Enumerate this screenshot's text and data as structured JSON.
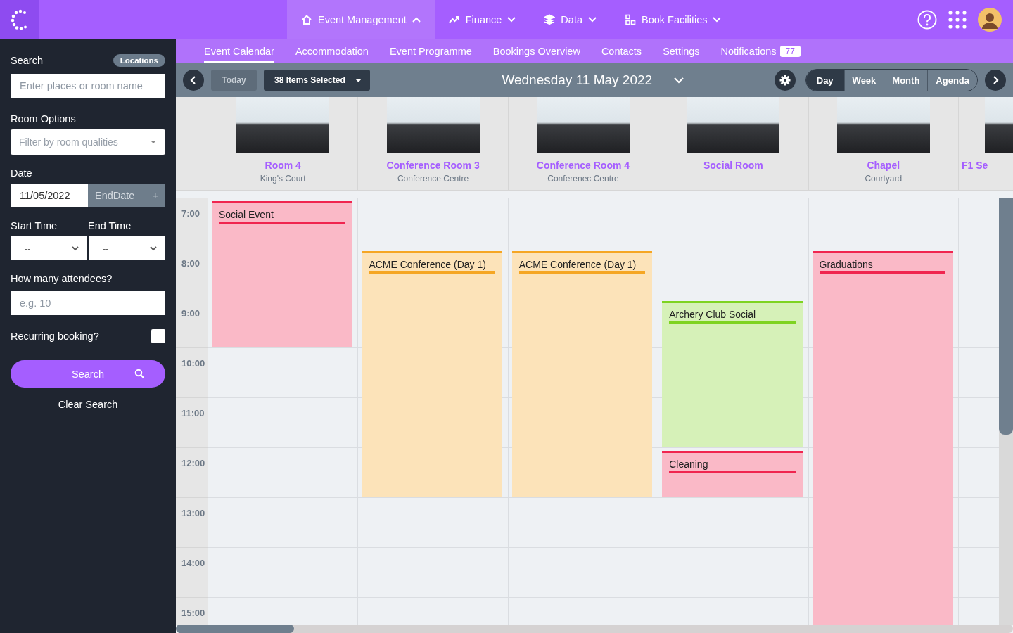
{
  "top_nav": [
    {
      "label": "Event Management",
      "expanded": true
    },
    {
      "label": "Finance",
      "expanded": false
    },
    {
      "label": "Data",
      "expanded": false
    },
    {
      "label": "Book Facilities",
      "expanded": false
    }
  ],
  "sub_nav": [
    {
      "label": "Event Calendar",
      "selected": true
    },
    {
      "label": "Accommodation",
      "selected": false
    },
    {
      "label": "Event Programme",
      "selected": false
    },
    {
      "label": "Bookings Overview",
      "selected": false
    },
    {
      "label": "Contacts",
      "selected": false
    },
    {
      "label": "Settings",
      "selected": false
    },
    {
      "label": "Notifications",
      "selected": false,
      "badge": "77"
    }
  ],
  "sidebar": {
    "search_label": "Search",
    "locations_badge": "Locations",
    "search_placeholder": "Enter places or room name",
    "room_options_label": "Room Options",
    "room_options_placeholder": "Filter by room qualities",
    "date_label": "Date",
    "date_value": "11/05/2022",
    "end_date_button": "EndDate",
    "end_date_plus": "+",
    "start_time_label": "Start Time",
    "end_time_label": "End Time",
    "start_time_value": "--",
    "end_time_value": "--",
    "attendees_label": "How many attendees?",
    "attendees_placeholder": "e.g. 10",
    "recurring_label": "Recurring booking?",
    "recurring_checked": false,
    "search_button": "Search",
    "clear_search": "Clear Search"
  },
  "toolbar": {
    "today": "Today",
    "items_selected": "38 Items Selected",
    "date_title": "Wednesday 11 May 2022",
    "views": [
      {
        "label": "Day",
        "selected": true
      },
      {
        "label": "Week",
        "selected": false
      },
      {
        "label": "Month",
        "selected": false
      },
      {
        "label": "Agenda",
        "selected": false
      }
    ]
  },
  "rooms": [
    {
      "name": "Room 4",
      "location": "King's Court",
      "events": [
        {
          "title": "Social Event",
          "color": "#f0254f"
        }
      ]
    },
    {
      "name": "Conference Room 3",
      "location": "Conference Centre",
      "events": [
        {
          "title": "ACME Conference (Day 1)",
          "color": "#f5a623"
        }
      ]
    },
    {
      "name": "Conference Room 4",
      "location": "Conferenec Centre",
      "events": [
        {
          "title": "ACME Conference (Day 1)",
          "color": "#f5a623"
        }
      ]
    },
    {
      "name": "Social Room",
      "events": [
        {
          "title": "Archery Club Social",
          "color": "#7ed321"
        },
        {
          "title": "Cleaning",
          "color": "#f0254f"
        }
      ]
    },
    {
      "name": "Chapel",
      "location": "Courtyard",
      "events": [
        {
          "title": "Graduations",
          "color": "#f0254f"
        }
      ]
    },
    {
      "name": "F1 Se"
    }
  ],
  "hours": [
    "7:00",
    "8:00",
    "9:00",
    "10:00",
    "11:00",
    "12:00",
    "13:00",
    "14:00",
    "15:00"
  ]
}
